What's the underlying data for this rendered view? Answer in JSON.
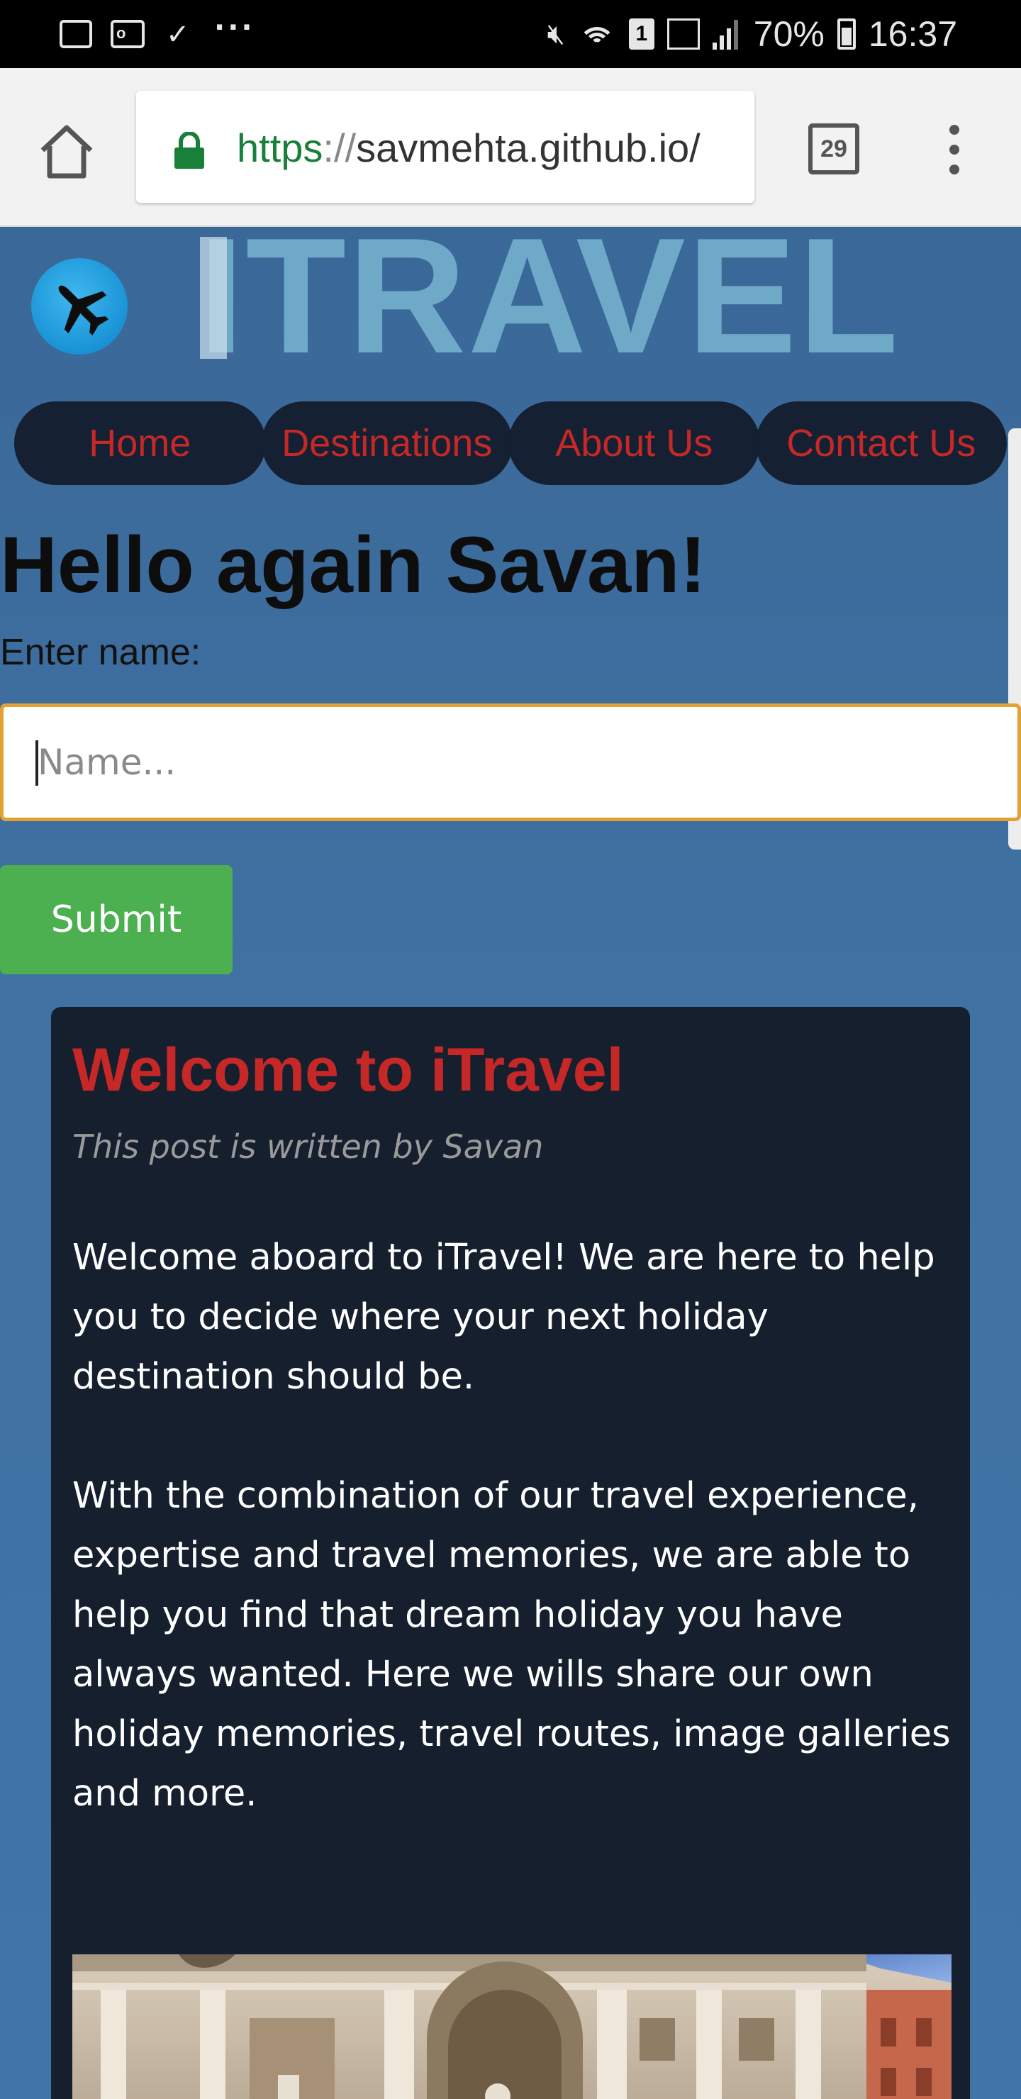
{
  "status_bar": {
    "notification_icons": [
      "gallery-icon",
      "outlook-icon",
      "tasks-icon",
      "more-dots-icon"
    ],
    "more": "···",
    "sim": "1",
    "battery_percent": "70%",
    "time": "16:37"
  },
  "browser": {
    "url_scheme": "https",
    "url_sep": "://",
    "url_host": "savmehta.github.io/",
    "tab_count": "29"
  },
  "site": {
    "brand": "ITRAVEL",
    "nav": [
      "Home",
      "Destinations",
      "About Us",
      "Contact Us"
    ]
  },
  "greeting": "Hello again Savan!",
  "form": {
    "label": "Enter name:",
    "placeholder": "Name...",
    "submit": "Submit"
  },
  "post": {
    "title": "Welcome to iTravel",
    "author": "This post is written by Savan",
    "paragraphs": [
      "Welcome aboard to iTravel! We are here to help you to decide where your next holiday destination should be.",
      "With the combination of our travel experience, expertise and travel memories, we are able to help you find that dream holiday you have always wanted. Here we wills share our own holiday memories, travel routes, image galleries and more."
    ]
  },
  "colors": {
    "page_bg": "#3a6a9c",
    "nav_bg": "#152132",
    "nav_text": "#c62828",
    "submit_bg": "#4caf50",
    "post_bg": "#151f2e",
    "brand": "#6fa9c8",
    "input_focus": "#e0a233"
  }
}
